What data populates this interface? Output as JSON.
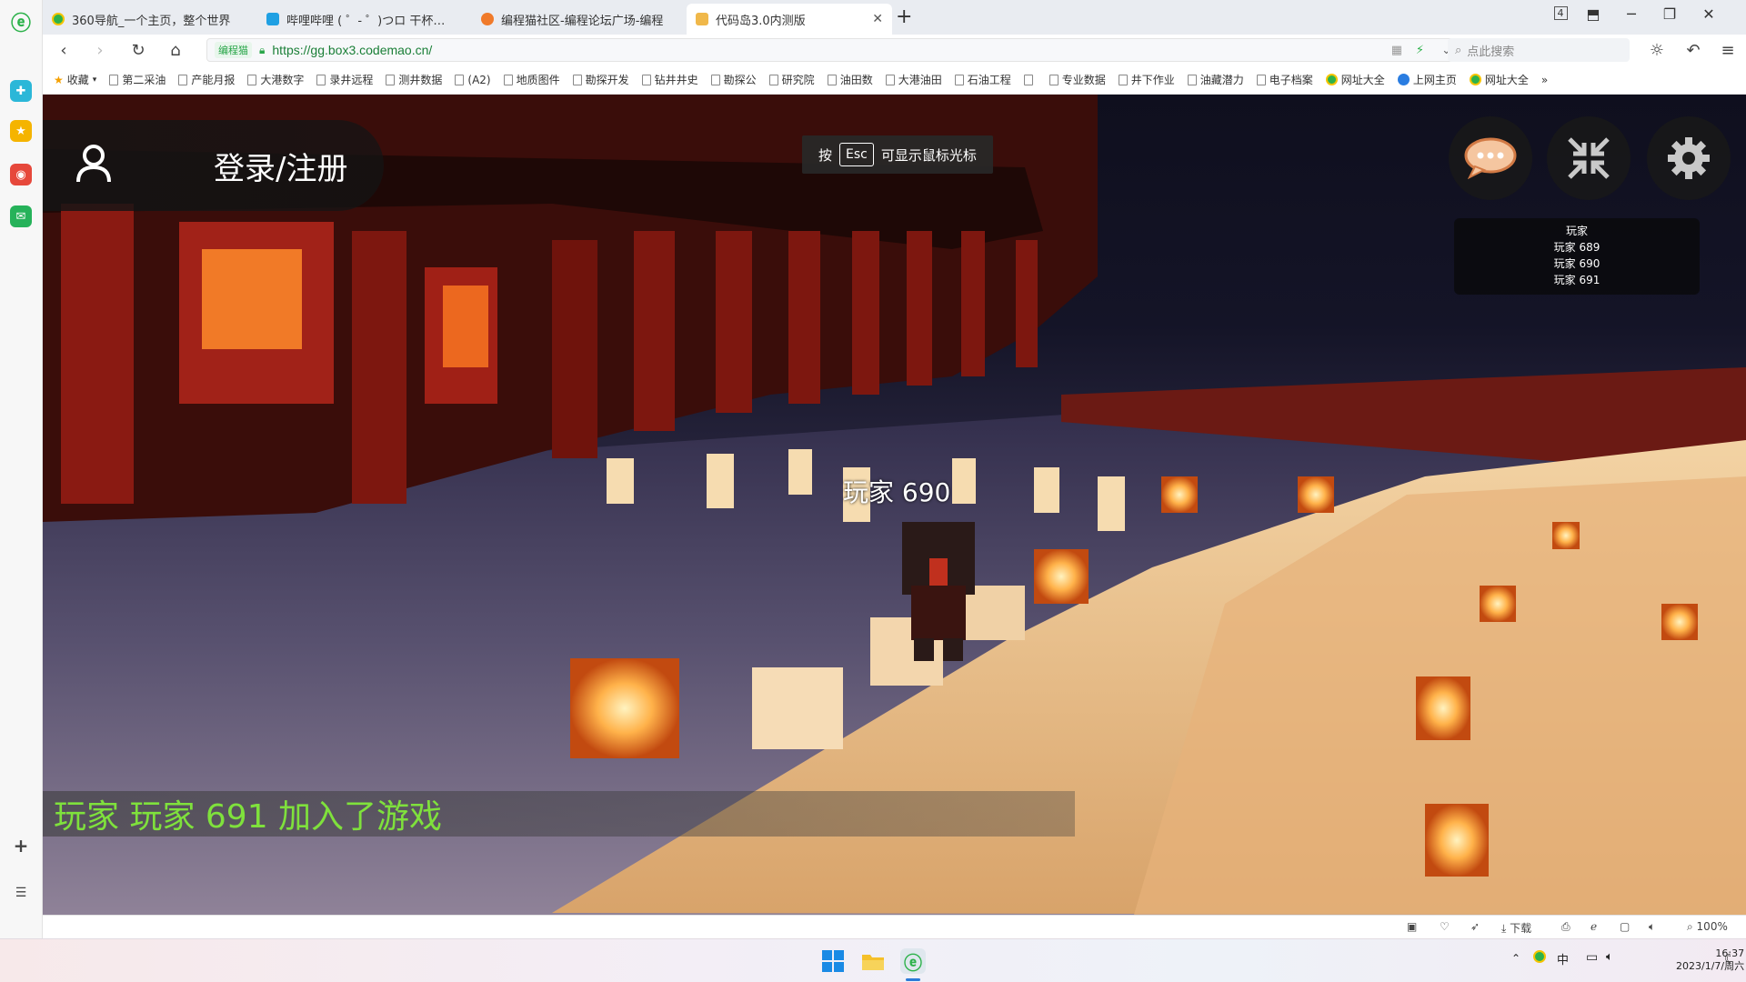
{
  "colors": {
    "accent": "#2db24b",
    "join_text": "#7fe13c",
    "url_green": "#1a7f37"
  },
  "tabs": [
    {
      "title": "360导航_一个主页，整个世界",
      "icon": "360-icon",
      "active": false
    },
    {
      "title": "哔哩哔哩 ( ゜- ゜)つロ 干杯~-bili",
      "icon": "bilibili-icon",
      "active": false
    },
    {
      "title": "编程猫社区-编程论坛广场-编程",
      "icon": "codemao-icon",
      "active": false
    },
    {
      "title": "代码岛3.0内测版",
      "icon": "box-icon",
      "active": true
    }
  ],
  "tab_count_badge": "4",
  "address": {
    "site_badge": "编程猫",
    "url": "https://gg.box3.codemao.cn/",
    "search_placeholder": "点此搜索"
  },
  "bookmarks": [
    "收藏",
    "第二采油",
    "产能月报",
    "大港数字",
    "录井远程",
    "测井数据",
    "(A2)",
    "地质图件",
    "勘探开发",
    "钻井井史",
    "勘探公",
    "研究院",
    "油田数",
    "大港油田",
    "石油工程",
    "",
    "专业数据",
    "井下作业",
    "油藏潜力",
    "电子档案",
    "网址大全",
    "上网主页",
    "网址大全"
  ],
  "bookmarks_more": "»",
  "game": {
    "esc_hint": {
      "prefix": "按",
      "key": "Esc",
      "suffix": "可显示鼠标光标"
    },
    "login_label": "登录/注册",
    "player_list": [
      "玩家",
      "玩家 689",
      "玩家 690",
      "玩家 691"
    ],
    "name_tag": "玩家 690",
    "join_message": "玩家 玩家 691 加入了游戏"
  },
  "statusbar": {
    "download": "下载",
    "zoom": "100%"
  },
  "taskbar": {
    "time": "16:37",
    "date": "2023/1/7/周六",
    "ime": "中"
  }
}
